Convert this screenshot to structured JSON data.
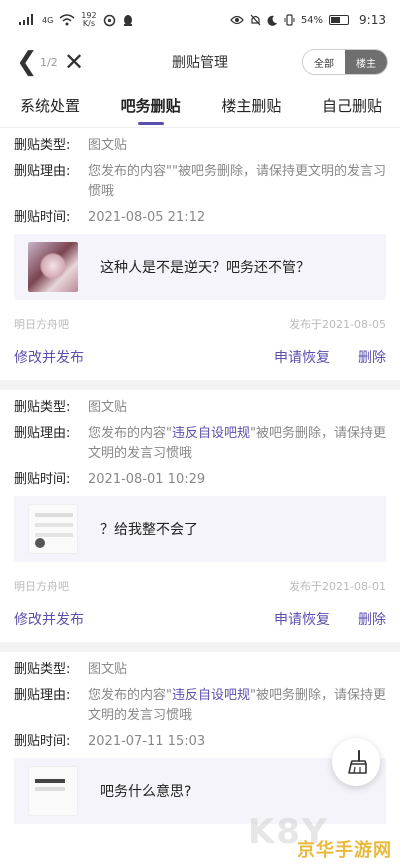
{
  "status_bar": {
    "network": "4G",
    "speed_value": "192",
    "speed_unit": "K/s",
    "battery": "54%",
    "time": "9:13"
  },
  "header": {
    "back_glyph": "❮",
    "pager": "1/2",
    "close_glyph": "✕",
    "title": "删贴管理",
    "toggle": [
      "全部",
      "楼主"
    ]
  },
  "tabs": [
    "系统处置",
    "吧务删贴",
    "楼主删贴",
    "自己删贴"
  ],
  "labels": {
    "type": "删贴类型:",
    "reason": "删贴理由:",
    "time": "删贴时间:"
  },
  "records": [
    {
      "type": "图文贴",
      "reason_pre": "您发布的内容\"\"被吧务删除，请保持更文明的发言习惯哦",
      "reason_highlight": "",
      "reason_post": "",
      "time": "2021-08-05 21:12",
      "post_text": "这种人是不是逆天？吧务还不管？",
      "forum": "明日方舟吧",
      "published": "发布于2021-08-05",
      "actions": [
        "修改并发布",
        "申请恢复",
        "删除"
      ]
    },
    {
      "type": "图文贴",
      "reason_pre": "您发布的内容\"",
      "reason_highlight": "违反自设吧规",
      "reason_post": "\"被吧务删除，请保持更文明的发言习惯哦",
      "time": "2021-08-01 10:29",
      "post_text": "？给我整不会了",
      "forum": "明日方舟吧",
      "published": "发布于2021-08-01",
      "actions": [
        "修改并发布",
        "申请恢复",
        "删除"
      ]
    },
    {
      "type": "图文贴",
      "reason_pre": "您发布的内容\"",
      "reason_highlight": "违反自设吧规",
      "reason_post": "\"被吧务删除，请保持更文明的发言习惯哦",
      "time": "2021-07-11 15:03",
      "post_text": "吧务什么意思?",
      "forum": "",
      "published": "",
      "actions": []
    }
  ],
  "watermark": {
    "big": "K8Y",
    "site": "京华手游网"
  },
  "colors": {
    "accent": "#5b4fb0",
    "muted": "#888888",
    "card_bg": "#f4f4fa"
  }
}
